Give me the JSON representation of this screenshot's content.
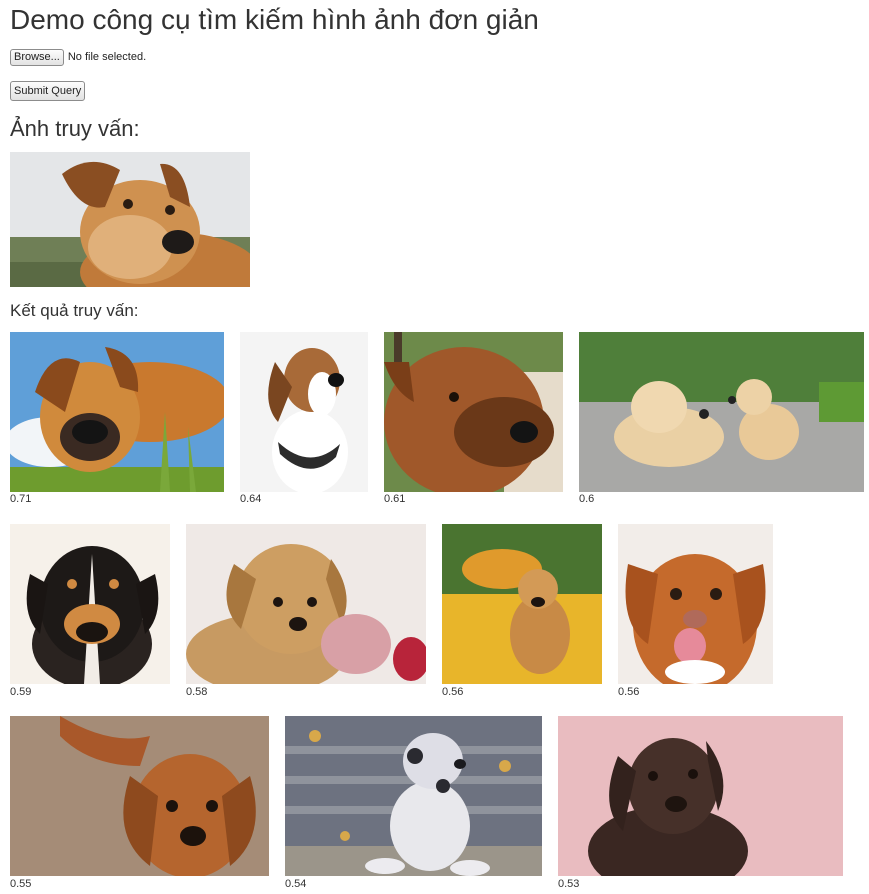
{
  "page": {
    "title": "Demo công cụ tìm kiếm hình ảnh đơn giản",
    "browse_label": "Browse...",
    "file_status": "No file selected.",
    "submit_label": "Submit Query",
    "query_heading": "Ảnh truy vấn:",
    "results_heading": "Kết quả truy vấn:"
  },
  "query_image": {
    "alt": "query-dog-photo"
  },
  "results": [
    {
      "score": "0.71",
      "desc": "dog-lying-in-grass"
    },
    {
      "score": "0.64",
      "desc": "beagle-with-collar"
    },
    {
      "score": "0.61",
      "desc": "brown-dog-profile"
    },
    {
      "score": "0.6",
      "desc": "labrador-and-puppy"
    },
    {
      "score": "0.59",
      "desc": "tricolor-puppy"
    },
    {
      "score": "0.58",
      "desc": "golden-puppy-with-toy"
    },
    {
      "score": "0.56",
      "desc": "golden-retriever-in-field"
    },
    {
      "score": "0.56",
      "desc": "toller-dog-smiling"
    },
    {
      "score": "0.55",
      "desc": "red-spaniel-looking-up"
    },
    {
      "score": "0.54",
      "desc": "merle-dog-on-steps"
    },
    {
      "score": "0.53",
      "desc": "chocolate-lab-puppy"
    }
  ]
}
